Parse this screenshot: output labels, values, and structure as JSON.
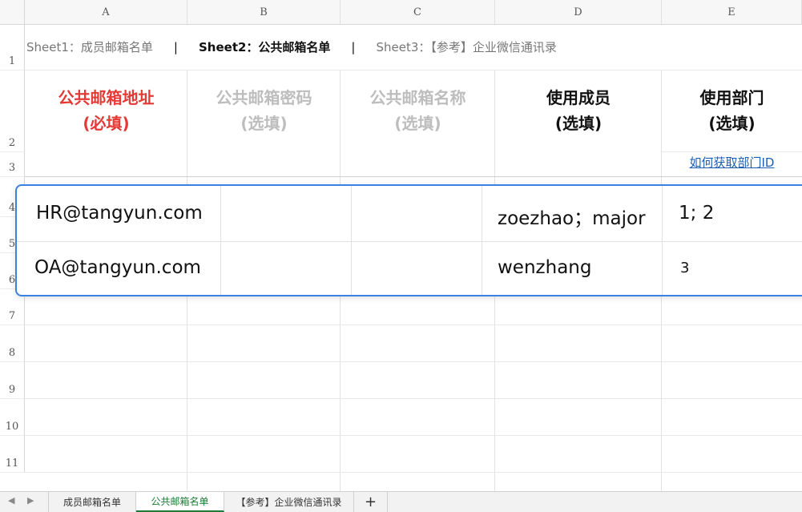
{
  "columns": [
    "A",
    "B",
    "C",
    "D",
    "E"
  ],
  "rows": [
    "1",
    "2",
    "3",
    "4",
    "5",
    "6",
    "7",
    "8",
    "9",
    "10",
    "11"
  ],
  "row1": {
    "sheet1": "Sheet1：成员邮箱名单",
    "sep1": "|",
    "sheet2": "Sheet2：公共邮箱名单",
    "sep2": "|",
    "sheet3": "Sheet3：【参考】企业微信通讯录"
  },
  "headers": [
    {
      "line1": "公共邮箱地址",
      "line2": "(必填)",
      "color": "#e53935"
    },
    {
      "line1": "公共邮箱密码",
      "line2": "(选填)",
      "color": "#bdbdbd"
    },
    {
      "line1": "公共邮箱名称",
      "line2": "(选填)",
      "color": "#bdbdbd"
    },
    {
      "line1": "使用成员",
      "line2": "(选填)",
      "color": "#111111"
    },
    {
      "line1": "使用部门",
      "line2": "(选填)",
      "color": "#111111"
    }
  ],
  "dept_link": "如何获取部门ID",
  "data_rows": [
    {
      "email": "HR@tangyun.com",
      "password": "",
      "name": "",
      "members": "zoezhao；major",
      "dept": "1; 2"
    },
    {
      "email": "OA@tangyun.com",
      "password": "",
      "name": "",
      "members": "wenzhang",
      "dept": "3"
    }
  ],
  "tabs": {
    "prev": "◀",
    "next": "▶",
    "items": [
      "成员邮箱名单",
      "公共邮箱名单",
      "【参考】企业微信通讯录"
    ],
    "active_index": 1,
    "add": "+"
  }
}
